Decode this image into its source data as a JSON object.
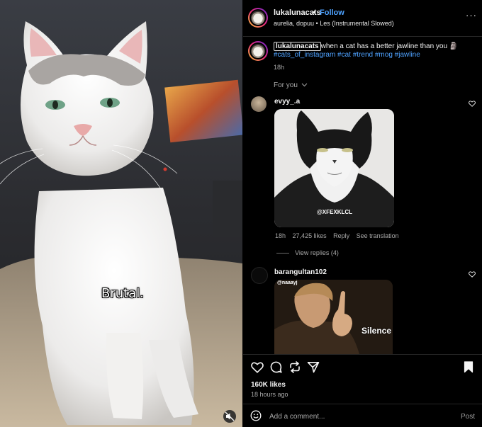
{
  "post": {
    "username": "lukalunacats",
    "separator": "•",
    "follow_label": "Follow",
    "audio_line": "aurelia, dopuu • Les (Instrumental Slowed)",
    "more_label": "···",
    "media_overlay_text": "Brutal."
  },
  "caption": {
    "username": "lukalunacats",
    "text": "when a cat has a better jawline than you 🗿",
    "hashtags": "#cats_of_instagram #cat #trend #mog #jawline",
    "time": "18h"
  },
  "sort": {
    "label": "For you"
  },
  "comments": [
    {
      "username": "evyy_.a",
      "image_watermark": "@XFEXKLCL",
      "time": "18h",
      "likes": "27,425 likes",
      "reply_label": "Reply",
      "translate_label": "See translation",
      "view_replies": "View replies (4)"
    },
    {
      "username": "barangultan102",
      "image_tag": "@naaayj",
      "image_overlay": "Silence"
    }
  ],
  "actions": {
    "likes": "160K likes",
    "time_ago": "18 hours ago"
  },
  "comment_box": {
    "placeholder": "Add a comment...",
    "post_label": "Post"
  },
  "colors": {
    "accent": "#4ea2ff",
    "background": "#000000",
    "muted_text": "#a8a8a8"
  }
}
